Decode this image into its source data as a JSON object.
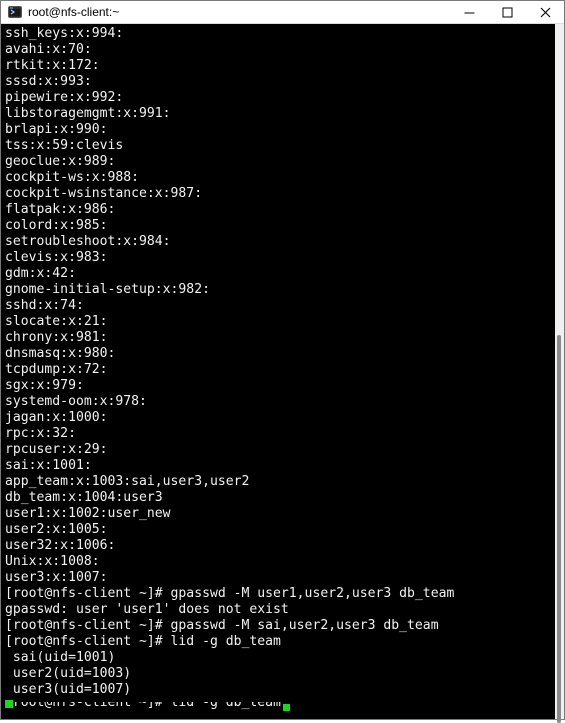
{
  "window": {
    "title": "root@nfs-client:~",
    "controls": {
      "minimize": "minimize",
      "maximize": "maximize",
      "close": "close"
    }
  },
  "terminal": {
    "lines": [
      "ssh_keys:x:994:",
      "avahi:x:70:",
      "rtkit:x:172:",
      "sssd:x:993:",
      "pipewire:x:992:",
      "libstoragemgmt:x:991:",
      "brlapi:x:990:",
      "tss:x:59:clevis",
      "geoclue:x:989:",
      "cockpit-ws:x:988:",
      "cockpit-wsinstance:x:987:",
      "flatpak:x:986:",
      "colord:x:985:",
      "setroubleshoot:x:984:",
      "clevis:x:983:",
      "gdm:x:42:",
      "gnome-initial-setup:x:982:",
      "sshd:x:74:",
      "slocate:x:21:",
      "chrony:x:981:",
      "dnsmasq:x:980:",
      "tcpdump:x:72:",
      "sgx:x:979:",
      "systemd-oom:x:978:",
      "jagan:x:1000:",
      "rpc:x:32:",
      "rpcuser:x:29:",
      "sai:x:1001:",
      "app_team:x:1003:sai,user3,user2",
      "db_team:x:1004:user3",
      "user1:x:1002:user_new",
      "user2:x:1005:",
      "user32:x:1006:",
      "Unix:x:1008:",
      "user3:x:1007:",
      "[root@nfs-client ~]# gpasswd -M user1,user2,user3 db_team",
      "gpasswd: user 'user1' does not exist",
      "[root@nfs-client ~]# gpasswd -M sai,user2,user3 db_team",
      "[root@nfs-client ~]# lid -g db_team",
      " sai(uid=1001)",
      " user2(uid=1003)",
      " user3(uid=1007)"
    ],
    "echo_line": "[root@nfs-client ~]# lid -g db_team"
  },
  "colors": {
    "background": "#000000",
    "foreground": "#f2f2f2",
    "cursor": "#21d321"
  }
}
